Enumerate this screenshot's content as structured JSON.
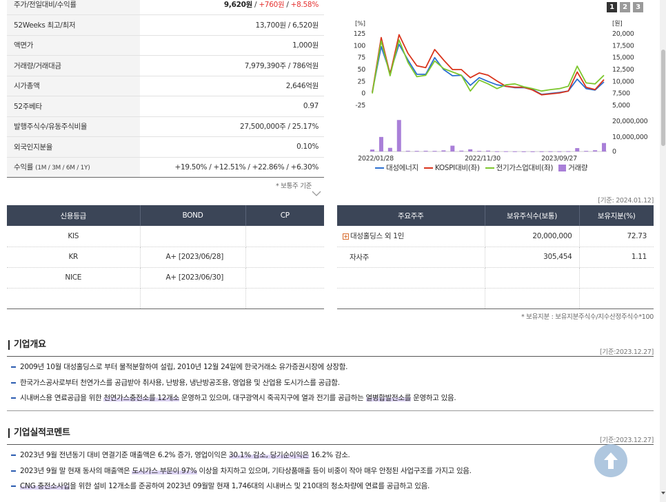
{
  "info_table": {
    "price": {
      "label": "주가/전일대비/수익률",
      "price": "9,620원",
      "sep1": " / ",
      "change": "+760원",
      "sep2": " / ",
      "rate": "+8.58%"
    },
    "week52": {
      "label": "52Weeks 최고/최저",
      "value": "13,700원 / 6,520원"
    },
    "par": {
      "label": "액면가",
      "value": "1,000원"
    },
    "volume": {
      "label": "거래량/거래대금",
      "value": "7,979,390주 / 786억원"
    },
    "market_cap": {
      "label": "시가총액",
      "value": "2,646억원"
    },
    "beta": {
      "label": "52주베타",
      "value": "0.97"
    },
    "shares": {
      "label": "발행주식수/유동주식비율",
      "value": "27,500,000주 / 25.17%"
    },
    "foreign": {
      "label": "외국인지분율",
      "value": "0.10%"
    },
    "returns": {
      "label": "수익률",
      "label_sub": "(1M / 3M / 6M / 1Y)",
      "value": "+19.50% / +12.51% / +22.86% / +6.30%"
    },
    "note": "* 보통주 기준"
  },
  "chart_tabs": [
    "1",
    "2",
    "3"
  ],
  "chart_data": {
    "type": "line",
    "y_left_unit": "[%]",
    "y_right_unit": "[원]",
    "y_left_ticks": [
      "125",
      "100",
      "75",
      "50",
      "25",
      "0",
      "-25"
    ],
    "y_right_ticks": [
      "20,000",
      "17,500",
      "15,000",
      "12,500",
      "10,000",
      "7,500",
      "5,000"
    ],
    "vol_ticks": [
      "20,000,000",
      "10,000,000",
      "0"
    ],
    "x_ticks": [
      "2022/01/28",
      "2022/11/30",
      "2023/09/27"
    ],
    "ylim": [
      -25,
      125
    ],
    "vol_lim": [
      0,
      25000000
    ],
    "series": [
      {
        "name": "대성에너지",
        "color": "#2b6fd0",
        "values": [
          3,
          98,
          43,
          103,
          70,
          40,
          40,
          75,
          50,
          37,
          38,
          17,
          33,
          25,
          18,
          15,
          12,
          12,
          8,
          -2,
          0,
          2,
          5,
          30,
          10,
          7,
          24
        ]
      },
      {
        "name": "KOSPI대비(좌)",
        "color": "#d9341c",
        "values": [
          2,
          117,
          40,
          123,
          84,
          58,
          54,
          92,
          70,
          50,
          50,
          33,
          43,
          38,
          26,
          15,
          13,
          13,
          7,
          -3,
          -1,
          1,
          5,
          45,
          13,
          8,
          29
        ]
      },
      {
        "name": "전기가스업대비(좌)",
        "color": "#7dc72e",
        "values": [
          0,
          110,
          37,
          112,
          65,
          35,
          38,
          68,
          52,
          45,
          38,
          5,
          28,
          20,
          10,
          18,
          20,
          14,
          10,
          5,
          8,
          10,
          15,
          57,
          22,
          20,
          38
        ]
      }
    ],
    "volume": {
      "name": "거래량",
      "color": "#a97fd8",
      "values": [
        1600000,
        12000000,
        3000000,
        26000000,
        600000,
        500000,
        600000,
        500000,
        900000,
        4800000,
        700000,
        1800000,
        500000,
        700000,
        200000,
        200000,
        150000,
        100000,
        100000,
        150000,
        200000,
        200000,
        250000,
        2800000,
        500000,
        1000000,
        7000000
      ]
    }
  },
  "chart_basis": "[기준: 2024.01.12]",
  "credit": {
    "headers": [
      "신용등급",
      "BOND",
      "CP"
    ],
    "rows": [
      [
        "KIS",
        "",
        ""
      ],
      [
        "KR",
        "A+  [2023/06/28]",
        ""
      ],
      [
        "NICE",
        "A+  [2023/06/30]",
        ""
      ],
      [
        "",
        "",
        ""
      ]
    ]
  },
  "holders": {
    "headers": [
      "주요주주",
      "보유주식수(보통)",
      "보유지분(%)"
    ],
    "rows": [
      [
        "대성홀딩스 외 1인",
        "20,000,000",
        "72.73"
      ],
      [
        "자사주",
        "305,454",
        "1.11"
      ],
      [
        "",
        "",
        ""
      ],
      [
        "",
        "",
        ""
      ]
    ],
    "note": "* 보유지분 : 보유지분주식수/지수산정주식수*100"
  },
  "overview": {
    "title": "기업개요",
    "date": "[기준:2023.12.27]",
    "line1": "2009년 10월 대성홀딩스로 부터 물적분할하여 설립, 2010년 12월 24일에 한국거래소 유가증권시장에 상장함.",
    "line2": "한국가스공사로부터 천연가스를 공급받아 취사용, 난방용, 냉난방공조용, 영업용 및 산업용 도시가스를 공급함.",
    "line3_a": "시내버스용 연료공급을 위한 ",
    "line3_hl1": "천연가스충전소를 12개소",
    "line3_b": " 운영하고 있으며, 대구광역시 죽곡지구에 열과 전기를 공급하는 ",
    "line3_hl2": "열병합발전소를",
    "line3_c": " 운영하고 있음."
  },
  "comment": {
    "title": "기업실적코멘트",
    "date": "[기준:2023.12.27]",
    "line1_a": "2023년 9월 전년동기 대비 연결기준 매출액은 6.2% 증가, 영업이익은 ",
    "line1_hl": "30.1% 감소, 당기순이익은",
    "line1_b": " 16.2% 감소.",
    "line2_a": "2023년 9월 말 현재 동사의 매출액은 ",
    "line2_hl": "도시가스 부문이 97%",
    "line2_b": " 이상을 차지하고 있으며, 기타상품매출 등이 비중이 작아 매우 안정된 사업구조를 가지고 있음.",
    "line3_hl": "CNG 충전소사업",
    "line3_b": "을 위한 설비 12개소를 준공하여 2023년 09월말 현재 1,746대의 시내버스 및 210대의 청소차량에 연료를 공급하고 있음."
  }
}
